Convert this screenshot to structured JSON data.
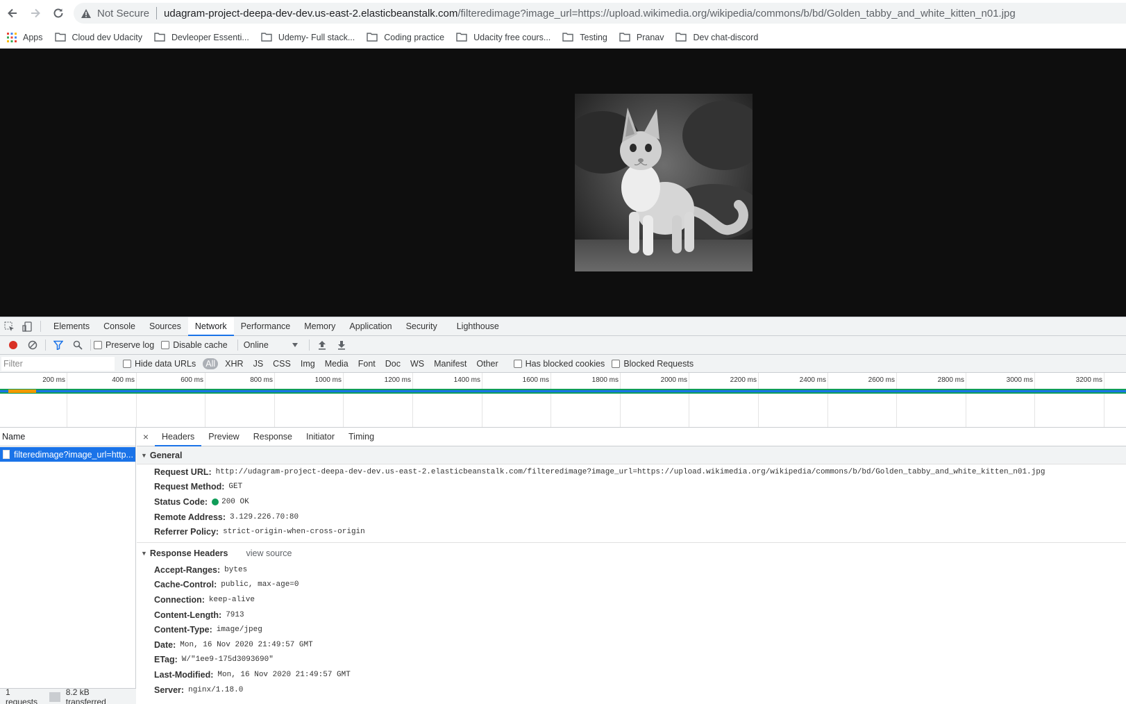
{
  "browser": {
    "security_label": "Not Secure",
    "url_host": "udagram-project-deepa-dev-dev.us-east-2.elasticbeanstalk.com",
    "url_path": "/filteredimage?image_url=https://upload.wikimedia.org/wikipedia/commons/b/bd/Golden_tabby_and_white_kitten_n01.jpg",
    "bookmarks": [
      {
        "label": "Apps",
        "icon": "apps-grid-icon"
      },
      {
        "label": "Cloud dev Udacity",
        "icon": "folder-icon"
      },
      {
        "label": "Devleoper Essenti...",
        "icon": "folder-icon"
      },
      {
        "label": "Udemy- Full stack...",
        "icon": "folder-icon"
      },
      {
        "label": "Coding practice",
        "icon": "folder-icon"
      },
      {
        "label": "Udacity free cours...",
        "icon": "folder-icon"
      },
      {
        "label": "Testing",
        "icon": "folder-icon"
      },
      {
        "label": "Pranav",
        "icon": "folder-icon"
      },
      {
        "label": "Dev chat-discord",
        "icon": "folder-icon"
      }
    ]
  },
  "devtools": {
    "tabs": [
      "Elements",
      "Console",
      "Sources",
      "Network",
      "Performance",
      "Memory",
      "Application",
      "Security",
      "Lighthouse"
    ],
    "active_tab": "Network",
    "toolbar": {
      "preserve_log": "Preserve log",
      "disable_cache": "Disable cache",
      "throttle": "Online"
    },
    "filter": {
      "placeholder": "Filter",
      "hide_data_urls": "Hide data URLs",
      "types": [
        "All",
        "XHR",
        "JS",
        "CSS",
        "Img",
        "Media",
        "Font",
        "Doc",
        "WS",
        "Manifest",
        "Other"
      ],
      "active_type": "All",
      "has_blocked_cookies": "Has blocked cookies",
      "blocked_requests": "Blocked Requests"
    },
    "timeline_ticks": [
      "200 ms",
      "400 ms",
      "600 ms",
      "800 ms",
      "1000 ms",
      "1200 ms",
      "1400 ms",
      "1600 ms",
      "1800 ms",
      "2000 ms",
      "2200 ms",
      "2400 ms",
      "2600 ms",
      "2800 ms",
      "3000 ms",
      "3200 ms"
    ],
    "request_list": {
      "header": "Name",
      "rows": [
        "filteredimage?image_url=http..."
      ],
      "summary_requests": "1 requests",
      "summary_transferred": "8.2 kB transferred"
    },
    "detail": {
      "tabs": [
        "Headers",
        "Preview",
        "Response",
        "Initiator",
        "Timing"
      ],
      "active_tab": "Headers",
      "general_title": "General",
      "general": [
        {
          "key": "Request URL:",
          "value": "http://udagram-project-deepa-dev-dev.us-east-2.elasticbeanstalk.com/filteredimage?image_url=https://upload.wikimedia.org/wikipedia/commons/b/bd/Golden_tabby_and_white_kitten_n01.jpg"
        },
        {
          "key": "Request Method:",
          "value": "GET"
        },
        {
          "key": "Status Code:",
          "value": "200 OK"
        },
        {
          "key": "Remote Address:",
          "value": "3.129.226.70:80"
        },
        {
          "key": "Referrer Policy:",
          "value": "strict-origin-when-cross-origin"
        }
      ],
      "response_title": "Response Headers",
      "view_source": "view source",
      "response_headers": [
        {
          "key": "Accept-Ranges:",
          "value": "bytes"
        },
        {
          "key": "Cache-Control:",
          "value": "public, max-age=0"
        },
        {
          "key": "Connection:",
          "value": "keep-alive"
        },
        {
          "key": "Content-Length:",
          "value": "7913"
        },
        {
          "key": "Content-Type:",
          "value": "image/jpeg"
        },
        {
          "key": "Date:",
          "value": "Mon, 16 Nov 2020 21:49:57 GMT"
        },
        {
          "key": "ETag:",
          "value": "W/\"1ee9-175d3093690\""
        },
        {
          "key": "Last-Modified:",
          "value": "Mon, 16 Nov 2020 21:49:57 GMT"
        },
        {
          "key": "Server:",
          "value": "nginx/1.18.0"
        }
      ]
    }
  },
  "colors": {
    "accent": "#1a73e8",
    "status_ok": "#0f9d58",
    "page_background": "#0e0e0e"
  }
}
